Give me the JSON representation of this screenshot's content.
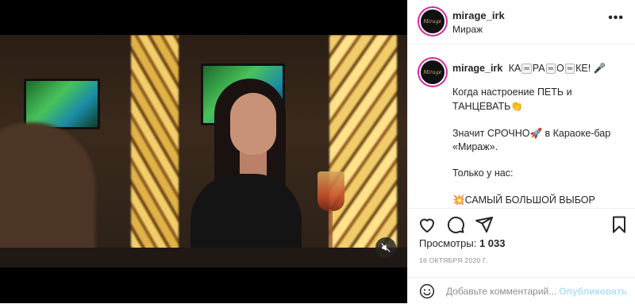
{
  "post": {
    "username": "mirage_irk",
    "location": "Мираж",
    "avatar_text": "Mirage",
    "more_label": "•••",
    "caption": {
      "line1_parts": [
        "КА",
        "РА",
        "О",
        "КЕ!"
      ],
      "line1_badge": "═",
      "line1_emoji": "🎤",
      "para2": "Когда настроение ПЕТЬ и ТАНЦЕВАТЬ",
      "para2_emoji": "👏",
      "para3_prefix": "Значит СРОЧНО",
      "para3_emoji": "🚀",
      "para3_suffix": " в Караоке-бар «Мираж».",
      "para4": "Только у нас:",
      "para5_emoji": "💥",
      "para5": "САМЫЙ БОЛЬШОЙ ВЫБОР"
    },
    "views_label": "Просмотры:",
    "views_count": "1 033",
    "date": "16 ОКТЯБРЯ 2020 Г.",
    "comment_placeholder": "Добавьте комментарий...",
    "post_button": "Опубликовать"
  },
  "icons": {
    "like": "heart-icon",
    "comment": "comment-bubble-icon",
    "share": "paper-plane-icon",
    "save": "bookmark-icon",
    "emoji": "smiley-icon",
    "mute": "speaker-muted-icon",
    "more": "more-options-icon"
  },
  "colors": {
    "text": "#262626",
    "muted": "#8e8e8e",
    "border": "#efefef",
    "post_button_disabled": "#b2dffc",
    "story_ring": "#d6249f"
  }
}
